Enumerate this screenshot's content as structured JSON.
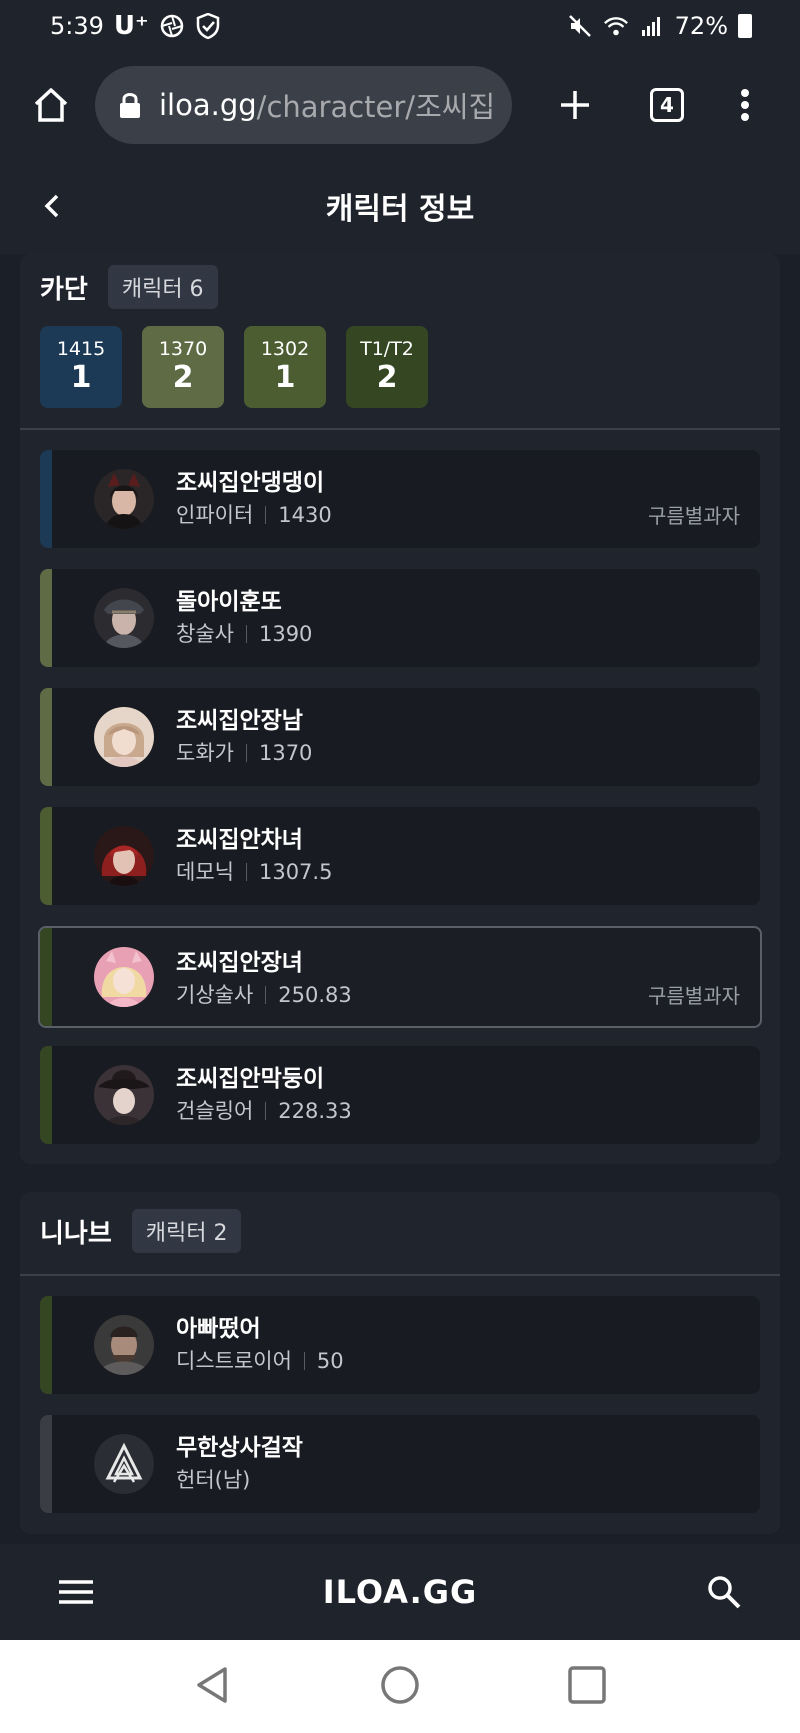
{
  "status": {
    "time": "5:39",
    "carrier": "U⁺",
    "battery": "72%"
  },
  "browser": {
    "url_host": "iloa.gg",
    "url_path": "/character/조씨집",
    "tab_count": "4"
  },
  "header": {
    "title": "캐릭터 정보"
  },
  "servers": [
    {
      "name": "카단",
      "count_label": "캐릭터 6",
      "tiers": [
        {
          "label": "1415",
          "count": "1",
          "color": "#1c3a55"
        },
        {
          "label": "1370",
          "count": "2",
          "color": "#5f6b45"
        },
        {
          "label": "1302",
          "count": "1",
          "color": "#4c5e31"
        },
        {
          "label": "T1/T2",
          "count": "2",
          "color": "#344722"
        }
      ],
      "characters": [
        {
          "name": "조씨집안댕댕이",
          "class": "인파이터",
          "level": "1430",
          "guild": "구름별과자",
          "accent": "#1c3a55"
        },
        {
          "name": "돌아이훈또",
          "class": "창술사",
          "level": "1390",
          "guild": "",
          "accent": "#5f6b45"
        },
        {
          "name": "조씨집안장남",
          "class": "도화가",
          "level": "1370",
          "guild": "",
          "accent": "#5f6b45"
        },
        {
          "name": "조씨집안차녀",
          "class": "데모닉",
          "level": "1307.5",
          "guild": "",
          "accent": "#4c5e31"
        },
        {
          "name": "조씨집안장녀",
          "class": "기상술사",
          "level": "250.83",
          "guild": "구름별과자",
          "accent": "#344722"
        },
        {
          "name": "조씨집안막둥이",
          "class": "건슬링어",
          "level": "228.33",
          "guild": "",
          "accent": "#344722"
        }
      ]
    },
    {
      "name": "니나브",
      "count_label": "캐릭터 2",
      "characters": [
        {
          "name": "아빠떴어",
          "class": "디스트로이어",
          "level": "50",
          "guild": "",
          "accent": "#344722"
        },
        {
          "name": "무한상사걸작",
          "class": "헌터(남)",
          "level": "",
          "guild": "",
          "accent": "#3a3d44"
        }
      ]
    }
  ],
  "app_bar": {
    "logo": "ILOA.GG"
  },
  "colors": {
    "background": "#1b1f27",
    "card": "#20242d",
    "row": "#181b21"
  }
}
